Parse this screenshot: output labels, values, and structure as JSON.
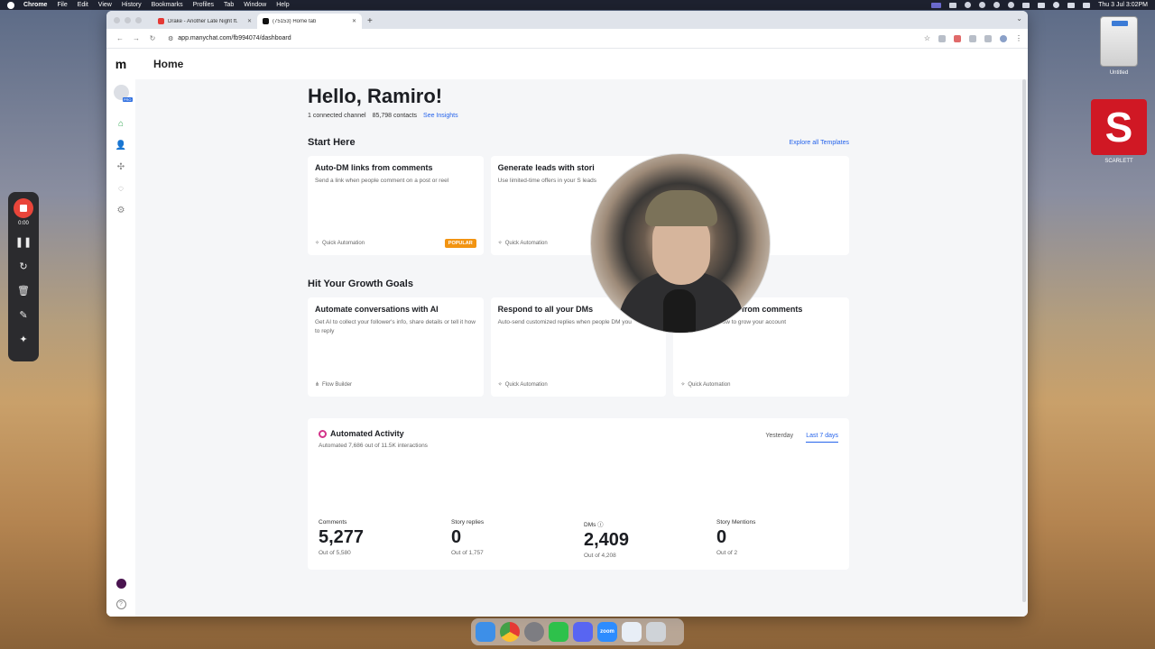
{
  "menubar": {
    "app": "Chrome",
    "items": [
      "File",
      "Edit",
      "View",
      "History",
      "Bookmarks",
      "Profiles",
      "Tab",
      "Window",
      "Help"
    ],
    "clock": "Thu 3 Jul  3:02PM"
  },
  "desktop": {
    "drive_label": "Untitled",
    "scarlett_label": "SCARLETT",
    "scarlett_letter": "S"
  },
  "recorder": {
    "time": "0:00"
  },
  "browser": {
    "tabs": [
      {
        "title": "Drake - Another Late Night ft.",
        "favicon_color": "#e53935"
      },
      {
        "title": "(75153) Home tab",
        "favicon_color": "#111111"
      }
    ],
    "url": "app.manychat.com/fb994074/dashboard"
  },
  "app": {
    "logo": "m",
    "page_title": "Home",
    "avatar_badge": "PRO",
    "help_glyph": "?",
    "greeting": "Hello, Ramiro!",
    "connected": "1 connected channel",
    "contacts": "85,798 contacts",
    "insights_link": "See Insights",
    "start_here": {
      "title": "Start Here",
      "link": "Explore all Templates",
      "cards": [
        {
          "title": "Auto-DM links from comments",
          "desc": "Send a link when people comment on a post or reel",
          "foot": "Quick Automation",
          "badge": "POPULAR"
        },
        {
          "title": "Generate leads with stori",
          "desc": "Use limited-time offers in your S leads",
          "foot": "Quick Automation",
          "badge": ""
        },
        {
          "title": "",
          "desc": "",
          "foot": "",
          "badge": ""
        }
      ]
    },
    "growth": {
      "title": "Hit Your Growth Goals",
      "cards": [
        {
          "title": "Automate conversations with AI",
          "desc": "Get AI to collect your follower's info, share details or tell it how to reply",
          "foot": "Flow Builder"
        },
        {
          "title": "Respond to all your DMs",
          "desc": "Auto-send customized replies when people DM you",
          "foot": "Quick Automation"
        },
        {
          "title": "Grow followers from comments",
          "desc": "Incentivize a follow to grow your account",
          "foot": "Quick Automation"
        }
      ]
    },
    "activity": {
      "title": "Automated Activity",
      "subtitle": "Automated 7,686 out of 11.5K interactions",
      "range": [
        "Yesterday",
        "Last 7 days"
      ],
      "metrics": [
        {
          "label": "Comments",
          "value": "5,277",
          "out": "Out of 5,580"
        },
        {
          "label": "Story replies",
          "value": "0",
          "out": "Out of 1,757"
        },
        {
          "label": "DMs",
          "value": "2,409",
          "out": "Out of 4,208"
        },
        {
          "label": "Story Mentions",
          "value": "0",
          "out": "Out of 2"
        }
      ]
    }
  },
  "dock": [
    {
      "name": "finder",
      "color": "#3d8fe8"
    },
    {
      "name": "chrome",
      "color": "#e9b93a"
    },
    {
      "name": "settings",
      "color": "#7d7d82"
    },
    {
      "name": "line",
      "color": "#2ec14b"
    },
    {
      "name": "discord",
      "color": "#5865f2"
    },
    {
      "name": "zoom",
      "color": "#2d8cff",
      "label": "zoom"
    },
    {
      "name": "preview",
      "color": "#e8eef6"
    },
    {
      "name": "trash",
      "color": "#cfd3d8"
    }
  ]
}
